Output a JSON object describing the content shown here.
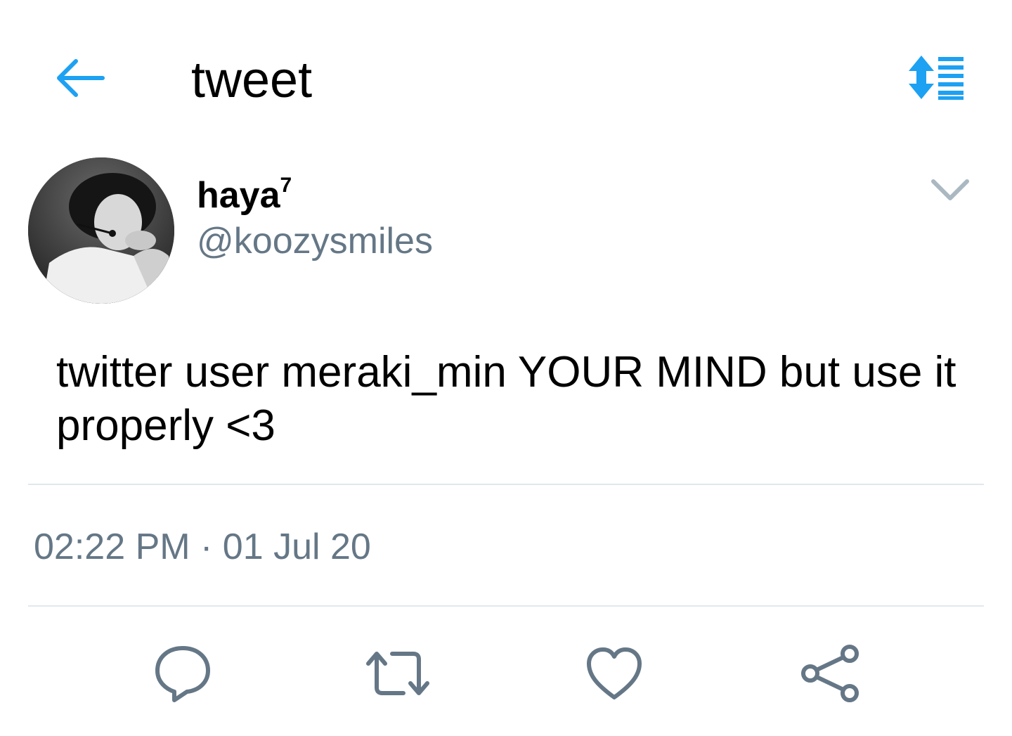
{
  "header": {
    "title": "tweet",
    "back_icon": "arrow-left-icon",
    "sort_icon": "sort-list-icon",
    "accent_color": "#1da1f2"
  },
  "author": {
    "display_name": "haya",
    "display_name_superscript": "7",
    "handle": "@koozysmiles",
    "avatar_icon": "profile-photo",
    "menu_icon": "chevron-down-icon"
  },
  "tweet": {
    "text": "twitter user meraki_min YOUR MIND but use it properly <3",
    "timestamp": "02:22 PM · 01 Jul 20"
  },
  "actions": {
    "reply_icon": "reply-icon",
    "retweet_icon": "retweet-icon",
    "like_icon": "heart-icon",
    "share_icon": "share-icon",
    "icon_color": "#657786"
  }
}
